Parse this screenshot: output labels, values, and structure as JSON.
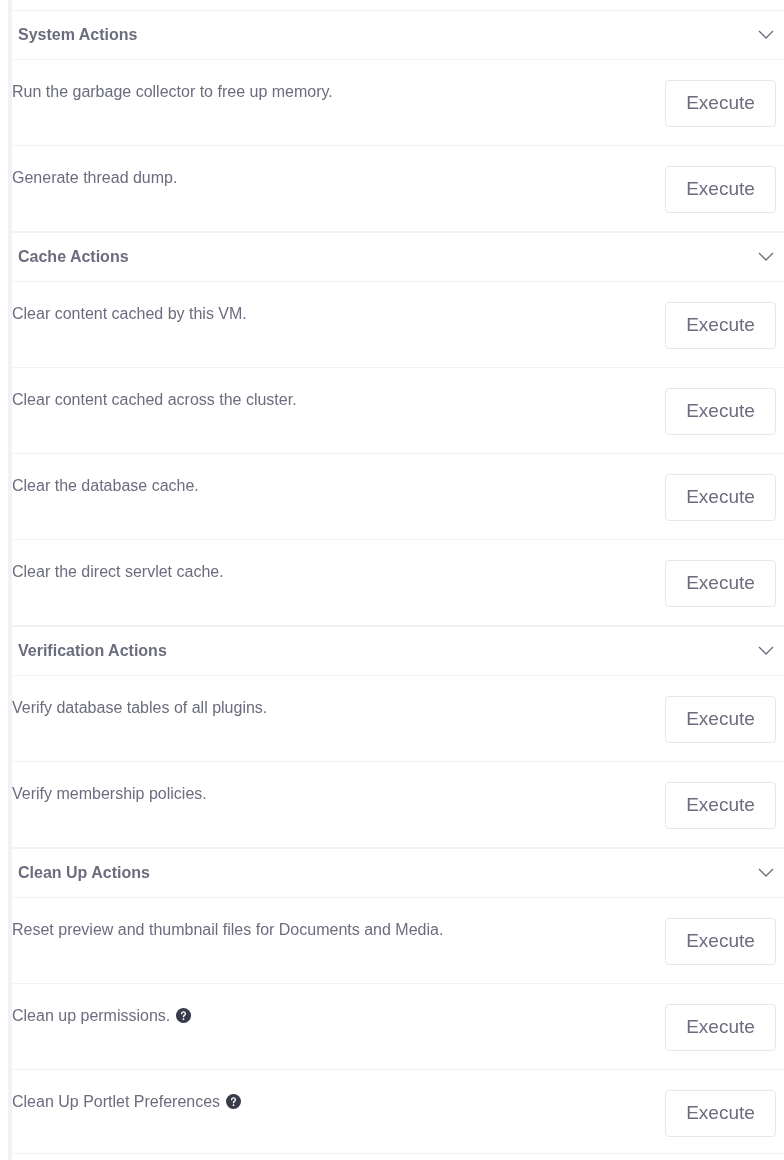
{
  "sections": [
    {
      "title": "System Actions",
      "expanded": true,
      "actions": [
        {
          "description": "Run the garbage collector to free up memory.",
          "help": false,
          "button": "Execute"
        },
        {
          "description": "Generate thread dump.",
          "help": false,
          "button": "Execute"
        }
      ]
    },
    {
      "title": "Cache Actions",
      "expanded": true,
      "actions": [
        {
          "description": "Clear content cached by this VM.",
          "help": false,
          "button": "Execute"
        },
        {
          "description": "Clear content cached across the cluster.",
          "help": false,
          "button": "Execute"
        },
        {
          "description": "Clear the database cache.",
          "help": false,
          "button": "Execute"
        },
        {
          "description": "Clear the direct servlet cache.",
          "help": false,
          "button": "Execute"
        }
      ]
    },
    {
      "title": "Verification Actions",
      "expanded": true,
      "actions": [
        {
          "description": "Verify database tables of all plugins.",
          "help": false,
          "button": "Execute"
        },
        {
          "description": "Verify membership policies.",
          "help": false,
          "button": "Execute"
        }
      ]
    },
    {
      "title": "Clean Up Actions",
      "expanded": true,
      "actions": [
        {
          "description": "Reset preview and thumbnail files for Documents and Media.",
          "help": false,
          "button": "Execute"
        },
        {
          "description": "Clean up permissions.",
          "help": true,
          "button": "Execute"
        },
        {
          "description": "Clean Up Portlet Preferences",
          "help": true,
          "button": "Execute"
        }
      ]
    }
  ]
}
